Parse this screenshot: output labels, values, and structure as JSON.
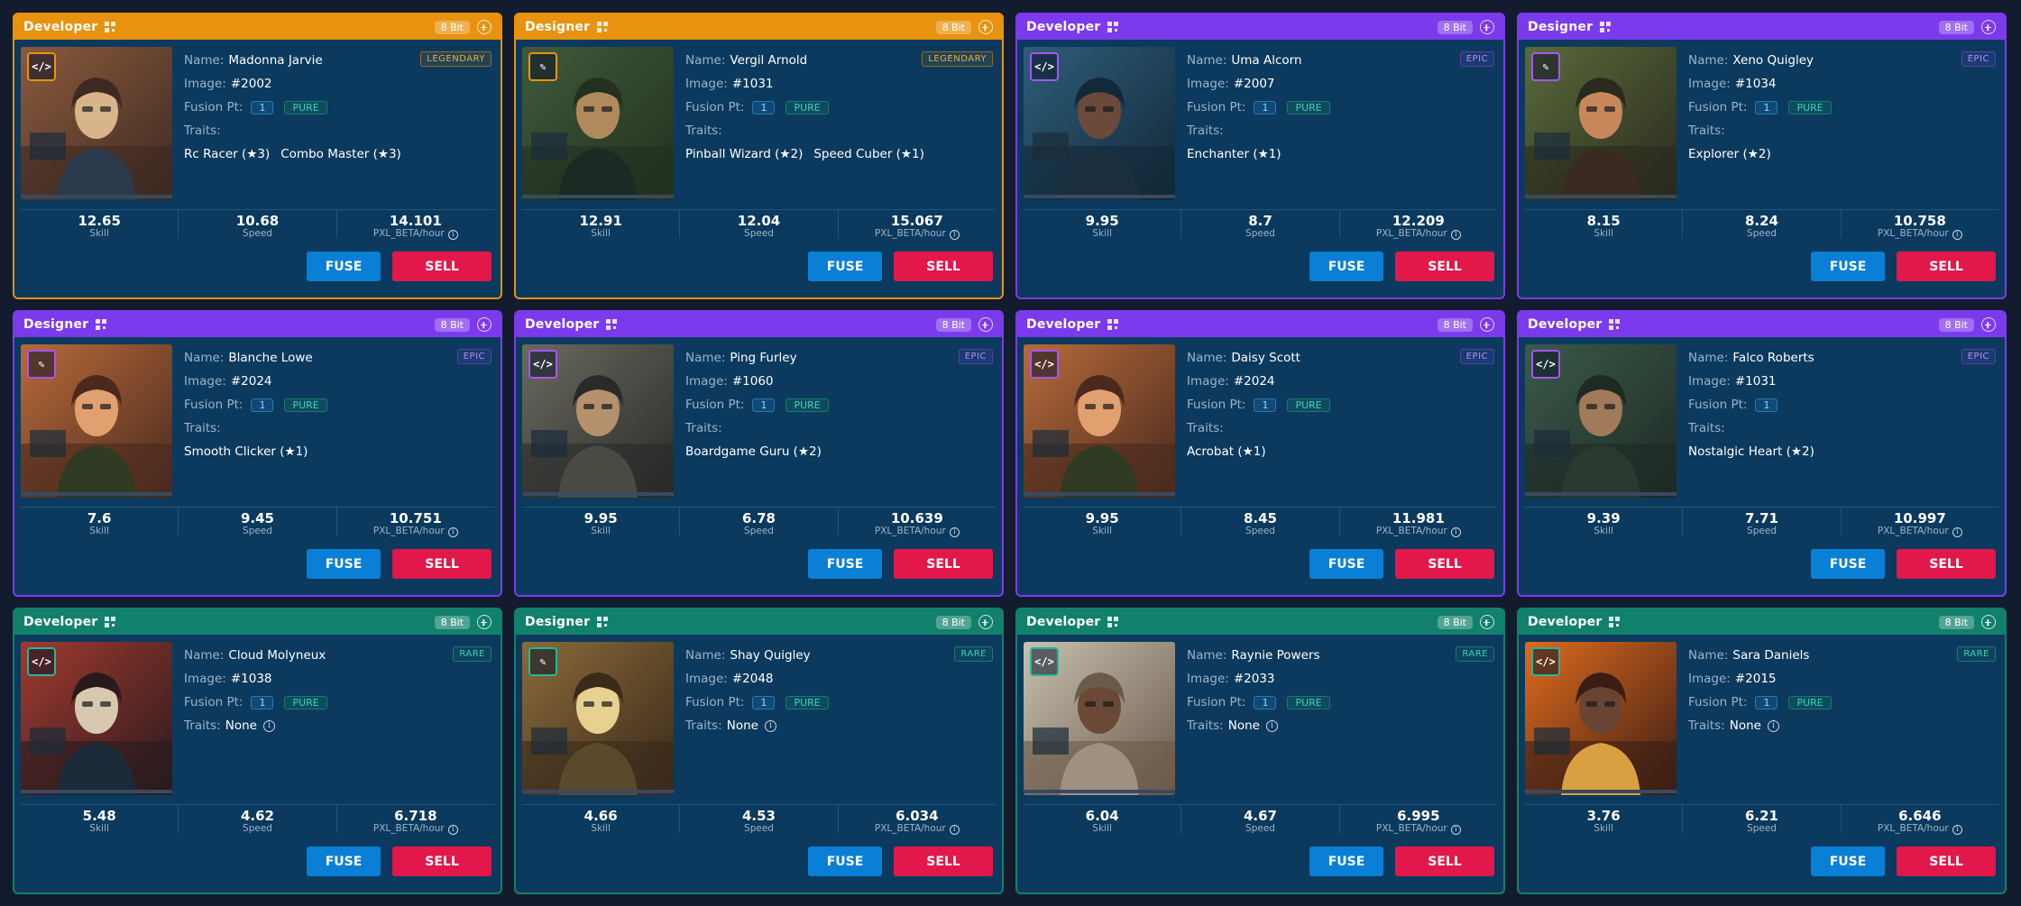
{
  "cards": [
    {
      "role": "Developer",
      "role_icon": "code-icon",
      "bit": "8 Bit",
      "rarity": "LEGENDARY",
      "name": "Madonna Jarvie",
      "image": "#2002",
      "fusion": "1",
      "pure": "PURE",
      "traits": [
        "Rc Racer (★3)",
        "Combo Master (★3)"
      ],
      "skill": "12.65",
      "speed": "10.68",
      "rate": "14.101"
    },
    {
      "role": "Designer",
      "role_icon": "design-tools-icon",
      "bit": "8 Bit",
      "rarity": "LEGENDARY",
      "name": "Vergil Arnold",
      "image": "#1031",
      "fusion": "1",
      "pure": "PURE",
      "traits": [
        "Pinball Wizard (★2)",
        "Speed Cuber (★1)"
      ],
      "skill": "12.91",
      "speed": "12.04",
      "rate": "15.067"
    },
    {
      "role": "Developer",
      "role_icon": "code-icon",
      "bit": "8 Bit",
      "rarity": "EPIC",
      "name": "Uma Alcorn",
      "image": "#2007",
      "fusion": "1",
      "pure": "PURE",
      "traits": [
        "Enchanter (★1)"
      ],
      "skill": "9.95",
      "speed": "8.7",
      "rate": "12.209"
    },
    {
      "role": "Designer",
      "role_icon": "design-tools-icon",
      "bit": "8 Bit",
      "rarity": "EPIC",
      "name": "Xeno Quigley",
      "image": "#1034",
      "fusion": "1",
      "pure": "PURE",
      "traits": [
        "Explorer (★2)"
      ],
      "skill": "8.15",
      "speed": "8.24",
      "rate": "10.758"
    },
    {
      "role": "Designer",
      "role_icon": "design-tools-icon",
      "bit": "8 Bit",
      "rarity": "EPIC",
      "name": "Blanche Lowe",
      "image": "#2024",
      "fusion": "1",
      "pure": "PURE",
      "traits": [
        "Smooth Clicker (★1)"
      ],
      "skill": "7.6",
      "speed": "9.45",
      "rate": "10.751"
    },
    {
      "role": "Developer",
      "role_icon": "code-icon",
      "bit": "8 Bit",
      "rarity": "EPIC",
      "name": "Ping Furley",
      "image": "#1060",
      "fusion": "1",
      "pure": "PURE",
      "traits": [
        "Boardgame Guru (★2)"
      ],
      "skill": "9.95",
      "speed": "6.78",
      "rate": "10.639"
    },
    {
      "role": "Developer",
      "role_icon": "code-icon",
      "bit": "8 Bit",
      "rarity": "EPIC",
      "name": "Daisy Scott",
      "image": "#2024",
      "fusion": "1",
      "pure": "PURE",
      "traits": [
        "Acrobat (★1)"
      ],
      "skill": "9.95",
      "speed": "8.45",
      "rate": "11.981"
    },
    {
      "role": "Developer",
      "role_icon": "code-icon",
      "bit": "8 Bit",
      "rarity": "EPIC",
      "name": "Falco Roberts",
      "image": "#1031",
      "fusion": "1",
      "pure": "",
      "traits": [
        "Nostalgic Heart (★2)"
      ],
      "skill": "9.39",
      "speed": "7.71",
      "rate": "10.997"
    },
    {
      "role": "Developer",
      "role_icon": "code-icon",
      "bit": "8 Bit",
      "rarity": "RARE",
      "name": "Cloud Molyneux",
      "image": "#1038",
      "fusion": "1",
      "pure": "PURE",
      "traits_none": "None",
      "skill": "5.48",
      "speed": "4.62",
      "rate": "6.718"
    },
    {
      "role": "Designer",
      "role_icon": "design-tools-icon",
      "bit": "8 Bit",
      "rarity": "RARE",
      "name": "Shay Quigley",
      "image": "#2048",
      "fusion": "1",
      "pure": "PURE",
      "traits_none": "None",
      "skill": "4.66",
      "speed": "4.53",
      "rate": "6.034"
    },
    {
      "role": "Developer",
      "role_icon": "code-icon",
      "bit": "8 Bit",
      "rarity": "RARE",
      "name": "Raynie Powers",
      "image": "#2033",
      "fusion": "1",
      "pure": "PURE",
      "traits_none": "None",
      "skill": "6.04",
      "speed": "4.67",
      "rate": "6.995"
    },
    {
      "role": "Developer",
      "role_icon": "code-icon",
      "bit": "8 Bit",
      "rarity": "RARE",
      "name": "Sara Daniels",
      "image": "#2015",
      "fusion": "1",
      "pure": "PURE",
      "traits_none": "None",
      "skill": "3.76",
      "speed": "6.21",
      "rate": "6.646"
    }
  ],
  "labels": {
    "name": "Name:",
    "image": "Image:",
    "fusion": "Fusion Pt:",
    "traits": "Traits:",
    "skill": "Skill",
    "speed": "Speed",
    "rate": "PXL_BETA/hour",
    "fuse": "FUSE",
    "sell": "SELL",
    "code_glyph": "</>",
    "design_glyph": "✎"
  },
  "colors": {
    "legendary": "#e8920f",
    "epic": "#7c3aed",
    "rare": "#11806d",
    "fuse_button": "#0a7fd6",
    "sell_button": "#e2184a"
  }
}
